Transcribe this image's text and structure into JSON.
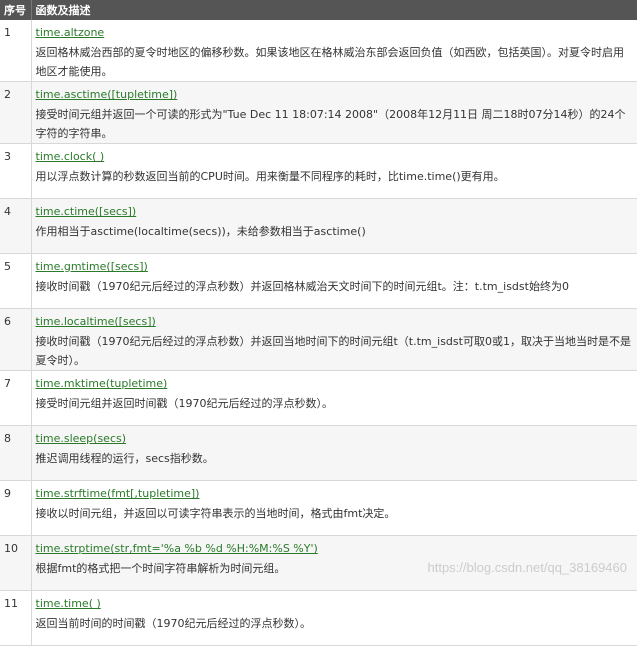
{
  "table": {
    "headers": [
      "序号",
      "函数及描述"
    ],
    "rows": [
      {
        "num": "1",
        "fn": "time.altzone",
        "desc": "返回格林威治西部的夏令时地区的偏移秒数。如果该地区在格林威治东部会返回负值（如西欧，包括英国）。对夏令时启用地区才能使用。"
      },
      {
        "num": "2",
        "fn": "time.asctime([tupletime])",
        "desc": "接受时间元组并返回一个可读的形式为\"Tue Dec 11 18:07:14 2008\"（2008年12月11日 周二18时07分14秒）的24个字符的字符串。"
      },
      {
        "num": "3",
        "fn": "time.clock( )",
        "desc": "用以浮点数计算的秒数返回当前的CPU时间。用来衡量不同程序的耗时，比time.time()更有用。"
      },
      {
        "num": "4",
        "fn": "time.ctime([secs])",
        "desc": "作用相当于asctime(localtime(secs))，未给参数相当于asctime()"
      },
      {
        "num": "5",
        "fn": "time.gmtime([secs])",
        "desc": "接收时间戳（1970纪元后经过的浮点秒数）并返回格林威治天文时间下的时间元组t。注：t.tm_isdst始终为0"
      },
      {
        "num": "6",
        "fn": "time.localtime([secs])",
        "desc": "接收时间戳（1970纪元后经过的浮点秒数）并返回当地时间下的时间元组t（t.tm_isdst可取0或1，取决于当地当时是不是夏令时）。"
      },
      {
        "num": "7",
        "fn": "time.mktime(tupletime)",
        "desc": "接受时间元组并返回时间戳（1970纪元后经过的浮点秒数）。"
      },
      {
        "num": "8",
        "fn": "time.sleep(secs)",
        "desc": "推迟调用线程的运行，secs指秒数。"
      },
      {
        "num": "9",
        "fn": "time.strftime(fmt[,tupletime])",
        "desc": "接收以时间元组，并返回以可读字符串表示的当地时间，格式由fmt决定。"
      },
      {
        "num": "10",
        "fn": "time.strptime(str,fmt='%a %b %d %H:%M:%S %Y')",
        "desc": "根据fmt的格式把一个时间字符串解析为时间元组。"
      },
      {
        "num": "11",
        "fn": "time.time( )",
        "desc": "返回当前时间的时间戳（1970纪元后经过的浮点秒数）。"
      }
    ]
  },
  "watermark": "https://blog.csdn.net/qq_38169460"
}
